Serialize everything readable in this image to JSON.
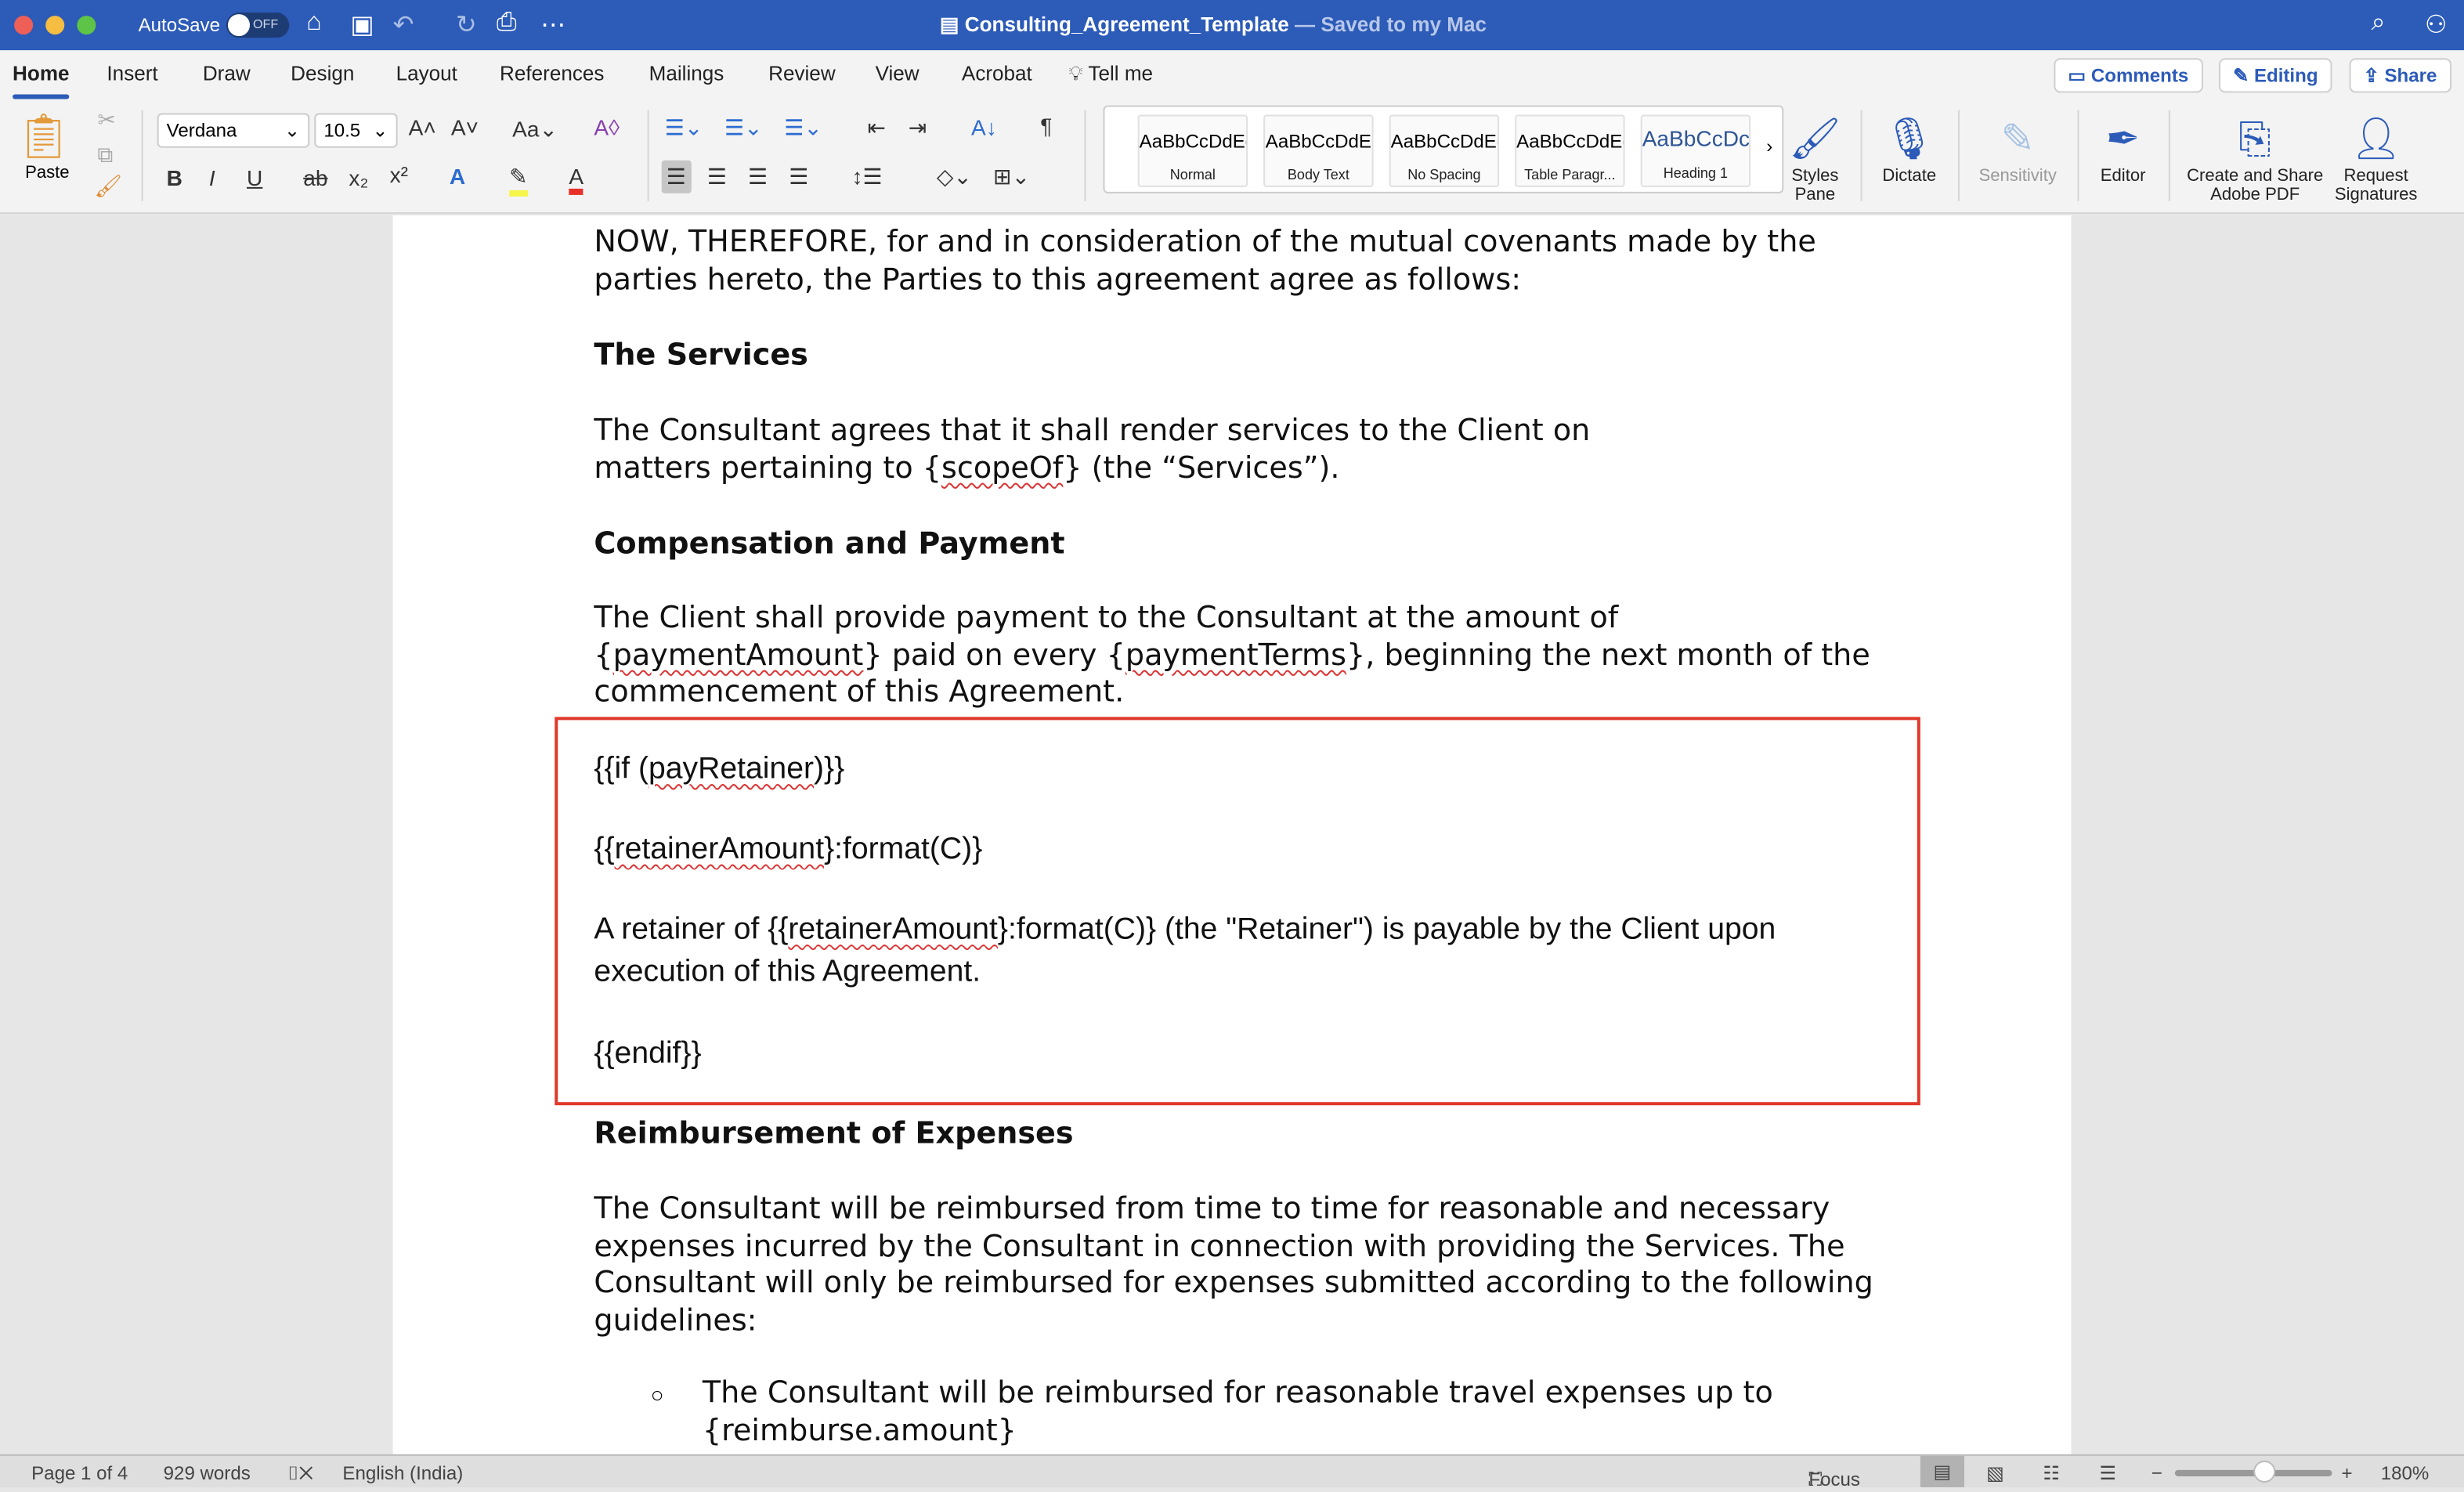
{
  "titlebar": {
    "autosave": "AutoSave",
    "toggle": "OFF",
    "filename": "Consulting_Agreement_Template",
    "saved": "— Saved to my Mac"
  },
  "tabs": [
    "Home",
    "Insert",
    "Draw",
    "Design",
    "Layout",
    "References",
    "Mailings",
    "Review",
    "View",
    "Acrobat",
    "Tell me"
  ],
  "top_buttons": {
    "comments": "Comments",
    "editing": "Editing",
    "share": "Share"
  },
  "font": {
    "name": "Verdana",
    "size": "10.5"
  },
  "paste": "Paste",
  "styles": [
    {
      "preview": "AaBbCcDdEe",
      "name": "Normal"
    },
    {
      "preview": "AaBbCcDdE",
      "name": "Body Text"
    },
    {
      "preview": "AaBbCcDdEe",
      "name": "No Spacing"
    },
    {
      "preview": "AaBbCcDdEe",
      "name": "Table Paragr..."
    },
    {
      "preview": "AaBbCcDc",
      "name": "Heading 1"
    }
  ],
  "big_buttons": {
    "styles_pane": "Styles Pane",
    "dictate": "Dictate",
    "sensitivity": "Sensitivity",
    "editor": "Editor",
    "adobe": "Create and Share Adobe PDF",
    "signatures": "Request Signatures"
  },
  "doc": {
    "p1": "NOW, THEREFORE, for and in consideration of the mutual covenants made by the parties hereto, the Parties to this agreement agree as follows:",
    "h_services": "The Services",
    "p2a": "The Consultant agrees that it shall render services to the Client on matters pertaining to {",
    "p2b": "scopeOf",
    "p2c": "} (the “Services”).",
    "h_comp": "Compensation and Payment",
    "p3a": "The Client shall provide payment to the Consultant at the amount of {",
    "p3b": "paymentAmount",
    "p3c": "} paid on every {",
    "p3d": "paymentTerms",
    "p3e": "}, beginning the next month of the commencement of this Agreement.",
    "c1a": "{{if (",
    "c1b": "payRetainer",
    "c1c": ")}}",
    "c2a": "{{",
    "c2b": "retainerAmount",
    "c2c": "}:format(C)}",
    "c3a": "A retainer of {{",
    "c3b": "retainerAmount",
    "c3c": "}:format(C)} (the \"Retainer\") is payable by the Client upon execution of this Agreement.",
    "c4": "{{endif}}",
    "h_reimb": "Reimbursement of Expenses",
    "p4": "The Consultant will be reimbursed from time to time for reasonable and necessary expenses incurred by the Consultant in connection with providing the Services. The Consultant will only be reimbursed for expenses submitted according to the following guidelines:",
    "bullet": "The Consultant will be reimbursed for reasonable travel expenses up to {reimburse.amount}"
  },
  "status": {
    "page": "Page 1 of 4",
    "words": "929 words",
    "language": "English (India)",
    "focus": "Focus",
    "zoom": "180%"
  },
  "colors": {
    "titlebar": "#2c5bb8",
    "highlight_box": "#e0392b"
  }
}
